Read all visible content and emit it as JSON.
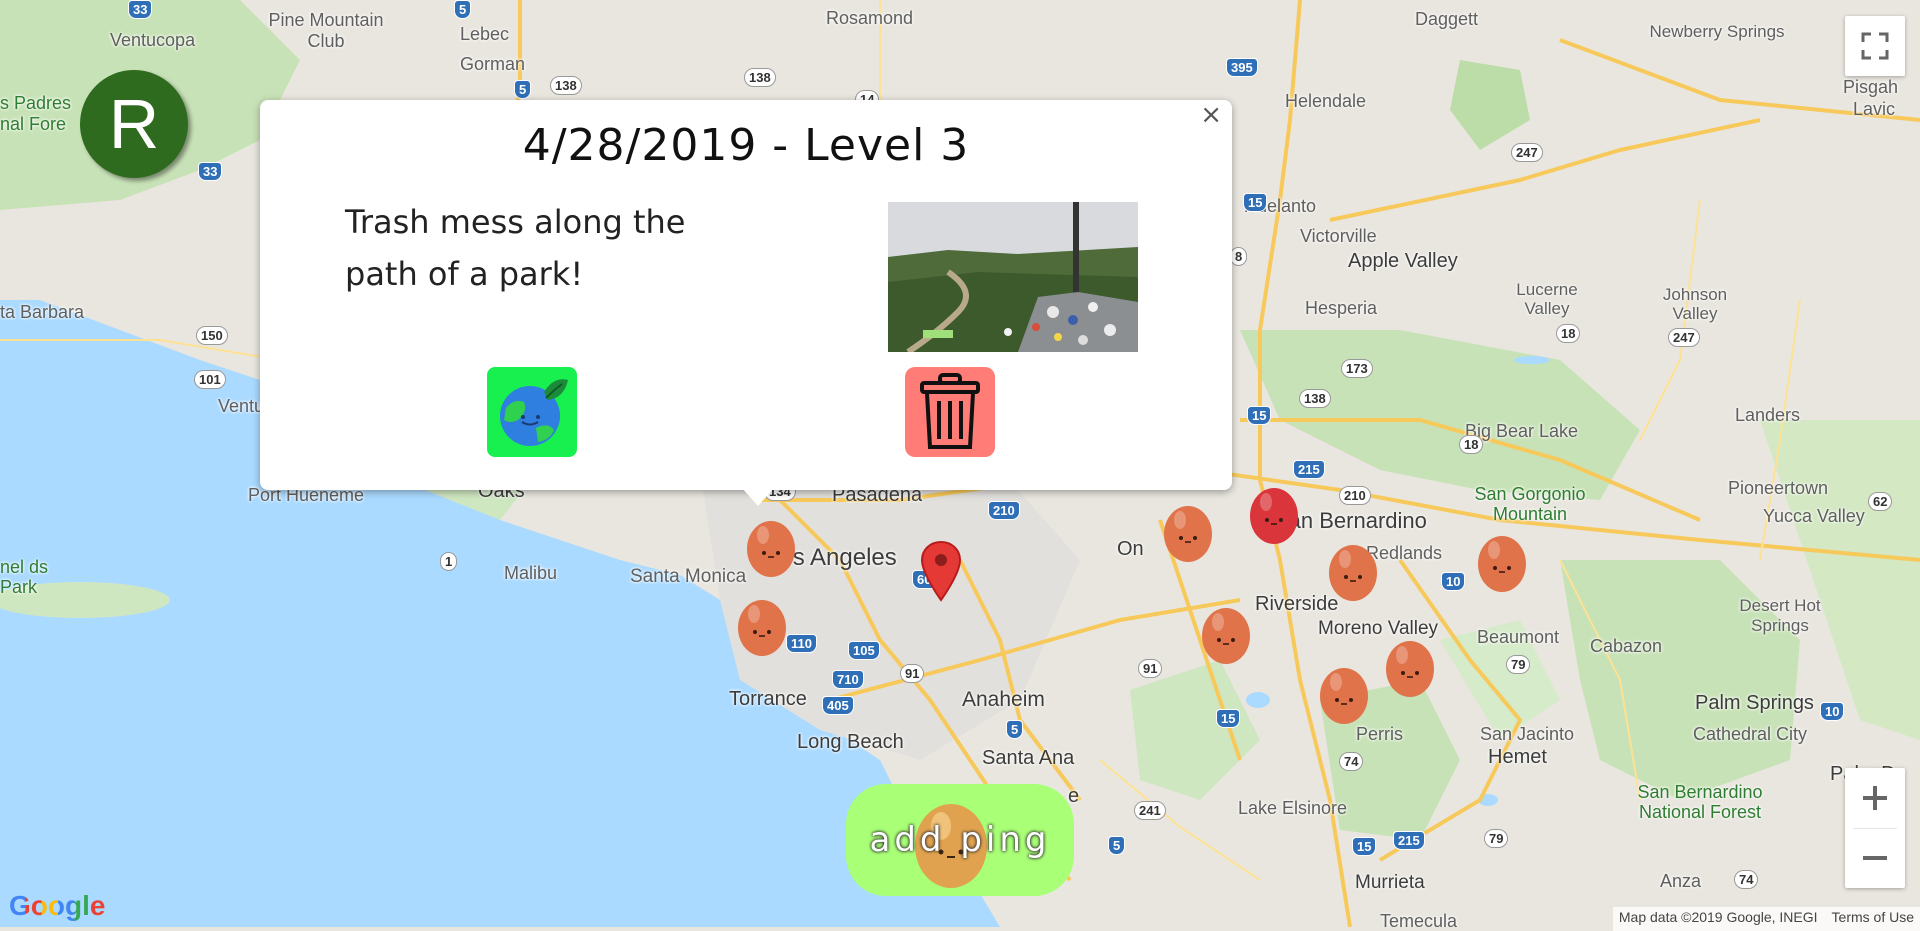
{
  "map": {
    "places": [
      {
        "id": "rosamond",
        "name": "Rosamond"
      },
      {
        "id": "daggett",
        "name": "Daggett"
      },
      {
        "id": "newberry",
        "name": "Newberry Springs"
      },
      {
        "id": "pisgah",
        "name": "Pisgah"
      },
      {
        "id": "lavic",
        "name": "Lavic"
      },
      {
        "id": "pinemountain",
        "name": "Pine Mountain Club"
      },
      {
        "id": "ventucopa",
        "name": "Ventucopa"
      },
      {
        "id": "lebec",
        "name": "Lebec"
      },
      {
        "id": "gorman",
        "name": "Gorman"
      },
      {
        "id": "padres",
        "name": "s Padres nal Fore"
      },
      {
        "id": "helendale",
        "name": "Helendale"
      },
      {
        "id": "adelanto",
        "name": "Adelanto"
      },
      {
        "id": "victorville",
        "name": "Victorville"
      },
      {
        "id": "applevalley",
        "name": "Apple Valley"
      },
      {
        "id": "hesperia",
        "name": "Hesperia"
      },
      {
        "id": "lucerne",
        "name": "Lucerne Valley"
      },
      {
        "id": "johnson",
        "name": "Johnson Valley"
      },
      {
        "id": "santabarbara",
        "name": "ta Barbara"
      },
      {
        "id": "ventura",
        "name": "Ventu"
      },
      {
        "id": "bigbear",
        "name": "Big Bear Lake"
      },
      {
        "id": "landers",
        "name": "Landers"
      },
      {
        "id": "pioneertown",
        "name": "Pioneertown"
      },
      {
        "id": "yucca",
        "name": "Yucca Valley"
      },
      {
        "id": "porthueneme",
        "name": "Port Hueneme"
      },
      {
        "id": "oaks",
        "name": "Oaks"
      },
      {
        "id": "pasadena",
        "name": "Pasadena"
      },
      {
        "id": "sanbernardino",
        "name": "San Bernardino"
      },
      {
        "id": "sangorgonio",
        "name": "San Gorgonio Mountain"
      },
      {
        "id": "redlands",
        "name": "Redlands"
      },
      {
        "id": "losangeles",
        "name": "Los Angeles"
      },
      {
        "id": "santamonica",
        "name": "Santa Monica"
      },
      {
        "id": "malibu",
        "name": "Malibu"
      },
      {
        "id": "ontario",
        "name": "On"
      },
      {
        "id": "riverside",
        "name": "Riverside"
      },
      {
        "id": "morenovalley",
        "name": "Moreno Valley"
      },
      {
        "id": "beaumont",
        "name": "Beaumont"
      },
      {
        "id": "cabazon",
        "name": "Cabazon"
      },
      {
        "id": "deserthot",
        "name": "Desert Hot Springs"
      },
      {
        "id": "channel",
        "name": "nel ds Park"
      },
      {
        "id": "torrance",
        "name": "Torrance"
      },
      {
        "id": "anaheim",
        "name": "Anaheim"
      },
      {
        "id": "longbeach",
        "name": "Long Beach"
      },
      {
        "id": "santaana",
        "name": "Santa Ana"
      },
      {
        "id": "perris",
        "name": "Perris"
      },
      {
        "id": "sanjacinto",
        "name": "San Jacinto"
      },
      {
        "id": "hemet",
        "name": "Hemet"
      },
      {
        "id": "palmsprings",
        "name": "Palm Springs"
      },
      {
        "id": "cathedral",
        "name": "Cathedral City"
      },
      {
        "id": "palmd",
        "name": "Palm D"
      },
      {
        "id": "sbnf",
        "name": "San Bernardino National Forest"
      },
      {
        "id": "lakeelsinore",
        "name": "Lake Elsinore"
      },
      {
        "id": "murrieta",
        "name": "Murrieta"
      },
      {
        "id": "anza",
        "name": "Anza"
      },
      {
        "id": "temecula",
        "name": "Temecula"
      },
      {
        "id": "ne",
        "name": "e"
      }
    ],
    "shields": [
      "33",
      "5",
      "33",
      "5",
      "138",
      "138",
      "395",
      "14",
      "247",
      "15",
      "8",
      "18",
      "247",
      "173",
      "138",
      "15",
      "215",
      "210",
      "18",
      "62",
      "150",
      "101",
      "134",
      "210",
      "605",
      "110",
      "105",
      "710",
      "91",
      "91",
      "405",
      "5",
      "15",
      "79",
      "215",
      "15",
      "10",
      "10",
      "74",
      "79",
      "74",
      "241",
      "5",
      "1"
    ],
    "attribution": "Map data ©2019 Google, INEGI",
    "terms": "Terms of Use",
    "google_logo": "Google"
  },
  "avatar": {
    "initial": "R"
  },
  "popup": {
    "title": "4/28/2019 - Level 3",
    "description": "Trash mess along the path of a park!",
    "close_glyph": "×"
  },
  "add_ping": {
    "label": "add ping"
  },
  "colors": {
    "ping_orange": "#e0734a",
    "ping_red": "#d9353a",
    "pin_red": "#e53935",
    "earth_btn": "#17f04f",
    "trash_btn": "#ff7c77",
    "add_ping_btn": "#a9ff76",
    "avatar": "#2f6b1e"
  }
}
